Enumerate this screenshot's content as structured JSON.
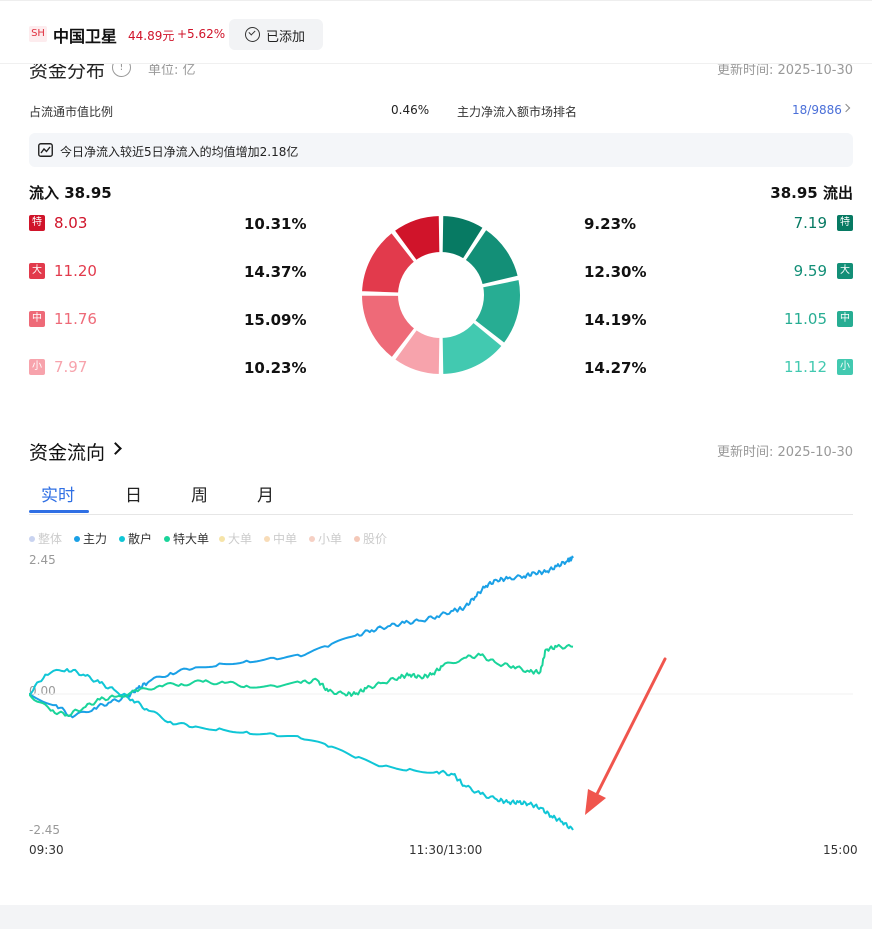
{
  "header": {
    "exchange": "SH",
    "stock_name": "中国卫星",
    "price": "44.89元",
    "change": "+5.62%",
    "added_label": "已添加"
  },
  "distribution": {
    "title": "资金分布",
    "unit": "单位: 亿",
    "update_time": "更新时间:  2025-10-30",
    "ratio_label": "占流通市值比例",
    "ratio_value": "0.46%",
    "rank_label": "主力净流入额市场排名",
    "rank_value": "18/9886",
    "tip": "今日净流入较近5日净流入的均值增加2.18亿",
    "inflow_label": "流入",
    "inflow_total": "38.95",
    "outflow_label": "流出",
    "outflow_total": "38.95",
    "rows": [
      {
        "badge": "特",
        "in_val": "8.03",
        "in_pct": "10.31%",
        "out_pct": "9.23%",
        "out_val": "7.19",
        "in_color": "#d0142a",
        "out_color": "#077a63"
      },
      {
        "badge": "大",
        "in_val": "11.20",
        "in_pct": "14.37%",
        "out_pct": "12.30%",
        "out_val": "9.59",
        "in_color": "#e23a4c",
        "out_color": "#138f77"
      },
      {
        "badge": "中",
        "in_val": "11.76",
        "in_pct": "15.09%",
        "out_pct": "14.19%",
        "out_val": "11.05",
        "in_color": "#ee6a78",
        "out_color": "#27ad93"
      },
      {
        "badge": "小",
        "in_val": "7.97",
        "in_pct": "10.23%",
        "out_pct": "14.27%",
        "out_val": "11.12",
        "in_color": "#f7a3ac",
        "out_color": "#42c9b0"
      }
    ]
  },
  "flow": {
    "title": "资金流向",
    "update_time": "更新时间:  2025-10-30",
    "tabs": [
      {
        "label": "实时",
        "active": true
      },
      {
        "label": "日",
        "active": false
      },
      {
        "label": "周",
        "active": false
      },
      {
        "label": "月",
        "active": false
      }
    ],
    "legend": [
      {
        "label": "整体",
        "color": "#c9d3f0",
        "active": false
      },
      {
        "label": "主力",
        "color": "#1aa0e6",
        "active": true
      },
      {
        "label": "散户",
        "color": "#10c6d6",
        "active": true
      },
      {
        "label": "特大单",
        "color": "#1ad49a",
        "active": true
      },
      {
        "label": "大单",
        "color": "#f6e4a8",
        "active": false
      },
      {
        "label": "中单",
        "color": "#f8dcb8",
        "active": false
      },
      {
        "label": "小单",
        "color": "#f6d0c4",
        "active": false
      },
      {
        "label": "股价",
        "color": "#f4c8b8",
        "active": false
      }
    ],
    "y_top": "2.45",
    "y_mid": "0.00",
    "y_bottom": "-2.45",
    "x_start": "09:30",
    "x_mid": "11:30/13:00",
    "x_end": "15:00"
  },
  "chart_data": {
    "type": "line",
    "x_range": [
      "09:30",
      "15:00"
    ],
    "ylim": [
      -2.45,
      2.45
    ],
    "series": [
      {
        "name": "主力",
        "color": "#1aa0e6",
        "points": [
          [
            0,
            0
          ],
          [
            0.05,
            -0.2
          ],
          [
            0.08,
            -0.42
          ],
          [
            0.12,
            -0.25
          ],
          [
            0.15,
            -0.15
          ],
          [
            0.18,
            -0.05
          ],
          [
            0.2,
            0.1
          ],
          [
            0.22,
            0.22
          ],
          [
            0.26,
            0.38
          ],
          [
            0.3,
            0.45
          ],
          [
            0.35,
            0.55
          ],
          [
            0.4,
            0.6
          ],
          [
            0.45,
            0.65
          ],
          [
            0.5,
            0.68
          ],
          [
            0.55,
            0.85
          ],
          [
            0.6,
            1.05
          ],
          [
            0.63,
            1.15
          ],
          [
            0.66,
            1.22
          ],
          [
            0.69,
            1.28
          ],
          [
            0.72,
            1.32
          ],
          [
            0.75,
            1.4
          ],
          [
            0.78,
            1.5
          ],
          [
            0.8,
            1.55
          ],
          [
            0.82,
            1.75
          ],
          [
            0.84,
            1.95
          ],
          [
            0.86,
            2.05
          ],
          [
            0.88,
            2.08
          ],
          [
            0.91,
            2.12
          ],
          [
            0.93,
            2.18
          ],
          [
            0.95,
            2.2
          ],
          [
            0.97,
            2.3
          ],
          [
            0.99,
            2.4
          ],
          [
            1.0,
            2.45
          ]
        ]
      },
      {
        "name": "散户",
        "color": "#10c6d6",
        "points": [
          [
            0,
            0
          ],
          [
            0.03,
            0.35
          ],
          [
            0.07,
            0.45
          ],
          [
            0.1,
            0.35
          ],
          [
            0.13,
            0.2
          ],
          [
            0.16,
            0.05
          ],
          [
            0.19,
            -0.1
          ],
          [
            0.22,
            -0.3
          ],
          [
            0.26,
            -0.5
          ],
          [
            0.3,
            -0.6
          ],
          [
            0.35,
            -0.62
          ],
          [
            0.4,
            -0.68
          ],
          [
            0.45,
            -0.72
          ],
          [
            0.5,
            -0.8
          ],
          [
            0.55,
            -0.95
          ],
          [
            0.6,
            -1.15
          ],
          [
            0.65,
            -1.3
          ],
          [
            0.7,
            -1.35
          ],
          [
            0.75,
            -1.4
          ],
          [
            0.78,
            -1.45
          ],
          [
            0.8,
            -1.65
          ],
          [
            0.83,
            -1.8
          ],
          [
            0.86,
            -1.9
          ],
          [
            0.88,
            -1.95
          ],
          [
            0.9,
            -1.95
          ],
          [
            0.92,
            -1.98
          ],
          [
            0.94,
            -2.05
          ],
          [
            0.96,
            -2.2
          ],
          [
            0.98,
            -2.3
          ],
          [
            1.0,
            -2.45
          ]
        ]
      },
      {
        "name": "特大单",
        "color": "#1ad49a",
        "points": [
          [
            0,
            0
          ],
          [
            0.04,
            -0.3
          ],
          [
            0.07,
            -0.38
          ],
          [
            0.1,
            -0.25
          ],
          [
            0.13,
            -0.1
          ],
          [
            0.16,
            -0.05
          ],
          [
            0.2,
            0.05
          ],
          [
            0.24,
            0.15
          ],
          [
            0.28,
            0.18
          ],
          [
            0.32,
            0.22
          ],
          [
            0.36,
            0.2
          ],
          [
            0.4,
            0.15
          ],
          [
            0.45,
            0.15
          ],
          [
            0.5,
            0.2
          ],
          [
            0.53,
            0.25
          ],
          [
            0.55,
            0.05
          ],
          [
            0.58,
            0.0
          ],
          [
            0.6,
            0.0
          ],
          [
            0.62,
            0.1
          ],
          [
            0.65,
            0.2
          ],
          [
            0.68,
            0.3
          ],
          [
            0.7,
            0.35
          ],
          [
            0.72,
            0.3
          ],
          [
            0.74,
            0.35
          ],
          [
            0.76,
            0.5
          ],
          [
            0.8,
            0.65
          ],
          [
            0.83,
            0.7
          ],
          [
            0.86,
            0.55
          ],
          [
            0.89,
            0.5
          ],
          [
            0.92,
            0.4
          ],
          [
            0.94,
            0.4
          ],
          [
            0.95,
            0.8
          ],
          [
            0.97,
            0.85
          ],
          [
            1.0,
            0.85
          ]
        ]
      }
    ]
  }
}
